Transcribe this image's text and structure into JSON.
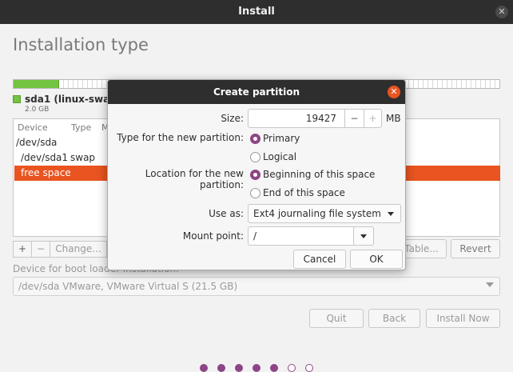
{
  "window": {
    "title": "Install",
    "close_glyph": "✕"
  },
  "page": {
    "title": "Installation type"
  },
  "disk": {
    "legend_label": "sda1 (linux-swap)",
    "legend_size": "2.0 GB",
    "swap_color": "#73c441"
  },
  "table": {
    "headers": [
      "Device",
      "Type",
      "M"
    ],
    "rows": [
      {
        "device": "/dev/sda",
        "type": ""
      },
      {
        "device": "/dev/sda1",
        "type": "swap"
      },
      {
        "device": "free space",
        "type": ""
      }
    ]
  },
  "toolbar": {
    "add": "+",
    "remove": "−",
    "change": "Change...",
    "new_table": "Table...",
    "revert": "Revert"
  },
  "bootloader": {
    "label": "Device for boot loader installation:",
    "value": "/dev/sda VMware, VMware Virtual S (21.5 GB)"
  },
  "nav": {
    "quit": "Quit",
    "back": "Back",
    "install": "Install Now"
  },
  "dialog": {
    "title": "Create partition",
    "close_glyph": "✕",
    "size_label": "Size:",
    "size_value": "19427",
    "size_minus": "−",
    "size_plus": "+",
    "size_unit": "MB",
    "type_label": "Type for the new partition:",
    "type_options": [
      "Primary",
      "Logical"
    ],
    "type_selected": "Primary",
    "location_label": "Location for the new partition:",
    "location_options": [
      "Beginning of this space",
      "End of this space"
    ],
    "location_selected": "Beginning of this space",
    "use_as_label": "Use as:",
    "use_as_value": "Ext4 journaling file system",
    "mount_label": "Mount point:",
    "mount_value": "/",
    "cancel": "Cancel",
    "ok": "OK"
  },
  "colors": {
    "accent": "#e95420",
    "radio": "#8e4585",
    "titlebar": "#2e2e2e"
  }
}
